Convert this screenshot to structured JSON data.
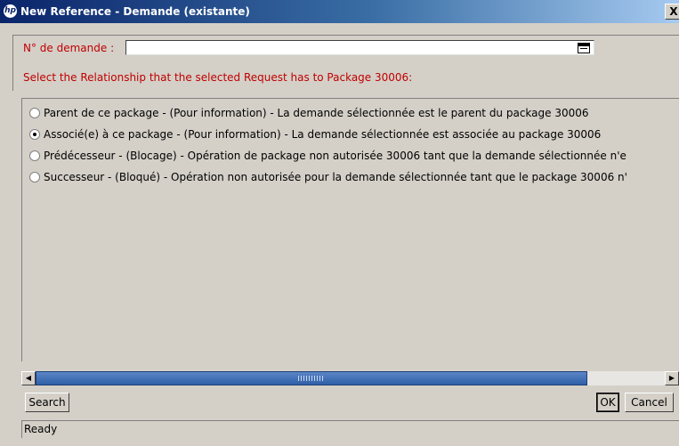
{
  "window": {
    "title": "New Reference - Demande (existante)",
    "close_label": "X",
    "logo_text": "hp"
  },
  "form": {
    "request_number_label": "N° de demande :",
    "request_number_value": "",
    "prompt": "Select the Relationship that the selected Request has to Package 30006:"
  },
  "relationships": [
    {
      "label": "Parent de ce package - (Pour information) - La demande sélectionnée est le parent du package 30006",
      "checked": false
    },
    {
      "label": "Associé(e) à ce package - (Pour information) - La demande sélectionnée est associée au package 30006",
      "checked": true
    },
    {
      "label": "Prédécesseur - (Blocage) - Opération de package non autorisée 30006 tant que la demande sélectionnée n'e",
      "checked": false
    },
    {
      "label": "Successeur - (Bloqué) - Opération non autorisée pour la demande sélectionnée tant que le package 30006 n'",
      "checked": false
    }
  ],
  "buttons": {
    "search": "Search",
    "ok": "OK",
    "cancel": "Cancel"
  },
  "status": "Ready",
  "icons": {
    "calendar": "calendar-icon",
    "scroll_left": "arrow-left-icon",
    "scroll_right": "arrow-right-icon"
  },
  "colors": {
    "label_red": "#c00000",
    "title_blue": "#0a246a",
    "scroll_thumb": "#3a6ea5"
  }
}
